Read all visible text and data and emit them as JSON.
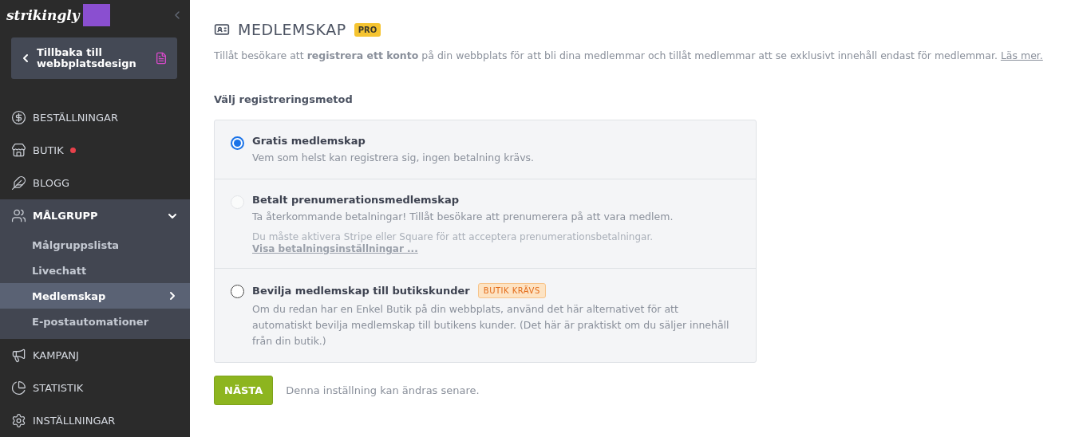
{
  "sidebar": {
    "logo": "strikingly",
    "back_button": "Tillbaka till webbplatsdesign",
    "items": [
      {
        "label": "BESTÄLLNINGAR",
        "dot": false,
        "expanded": false
      },
      {
        "label": "BUTIK",
        "dot": true,
        "expanded": false
      },
      {
        "label": "BLOGG",
        "dot": false,
        "expanded": false
      },
      {
        "label": "MÅLGRUPP",
        "dot": false,
        "expanded": true,
        "children": [
          {
            "label": "Målgruppslista",
            "selected": false
          },
          {
            "label": "Livechatt",
            "selected": false
          },
          {
            "label": "Medlemskap",
            "selected": true
          },
          {
            "label": "E-postautomationer",
            "selected": false
          }
        ]
      },
      {
        "label": "KAMPANJ",
        "dot": false,
        "expanded": false
      },
      {
        "label": "STATISTIK",
        "dot": false,
        "expanded": false
      },
      {
        "label": "INSTÄLLNINGAR",
        "dot": false,
        "expanded": false
      }
    ]
  },
  "page": {
    "title": "MEDLEMSKAP",
    "badge": "PRO",
    "intro": "Tillåt besökare att **registrera ett konto** på din webbplats för att bli dina medlemmar och tillåt medlemmar att se exklusivt innehåll endast för medlemmar.",
    "intro_link": "Läs mer.",
    "section_label": "Välj registreringsmetod",
    "options": [
      {
        "title": "Gratis medlemskap",
        "selected": true,
        "disabled": false,
        "description": "Vem som helst kan registrera sig, ingen betalning krävs."
      },
      {
        "title": "Betalt prenumerationsmedlemskap",
        "selected": false,
        "disabled": true,
        "description": "Ta återkommande betalningar! Tillåt besökare att prenumerera på att vara medlem.",
        "note": "Du måste aktivera Stripe eller Square för att acceptera prenumerationsbetalningar.",
        "note_link": "Visa betalningsinställningar ..."
      },
      {
        "title": "Bevilja medlemskap till butikskunder",
        "selected": false,
        "disabled": false,
        "badge": "BUTIK KRÄVS",
        "description": "Om du redan har en Enkel Butik på din webbplats, använd det här alternativet för att automatiskt bevilja medlemskap till butikens kunder. (Det här är praktiskt om du säljer innehåll från din butik.)"
      }
    ],
    "next_button": "NÄSTA",
    "footer_note": "Denna inställning kan ändras senare."
  }
}
